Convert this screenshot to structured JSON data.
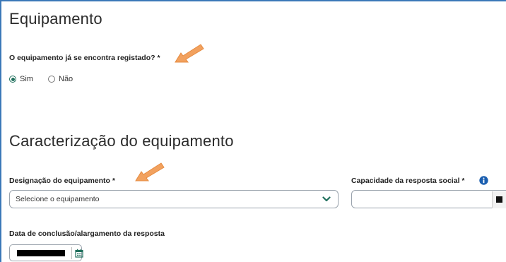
{
  "equipamento_section": {
    "title": "Equipamento",
    "question_label": "O equipamento já se encontra registado? *",
    "options": [
      {
        "label": "Sim",
        "selected": true
      },
      {
        "label": "Não",
        "selected": false
      }
    ]
  },
  "caracterizacao_section": {
    "title": "Caracterização do equipamento",
    "designacao_label": "Designação do equipamento *",
    "designacao_placeholder": "Selecione o equipamento",
    "capacidade_label": "Capacidade da resposta social *",
    "data_conclusao_label": "Data de conclusão/alargamento da resposta"
  },
  "icons": {
    "info": "info-icon",
    "dropdown": "chevron-down-icon",
    "calendar": "calendar-icon",
    "annotation": "arrow-icon"
  },
  "colors": {
    "accent_green": "#1f6f5c",
    "frame_blue": "#3b78b8",
    "info_blue": "#1b5fb0",
    "annotation_orange": "#f2a15e"
  }
}
